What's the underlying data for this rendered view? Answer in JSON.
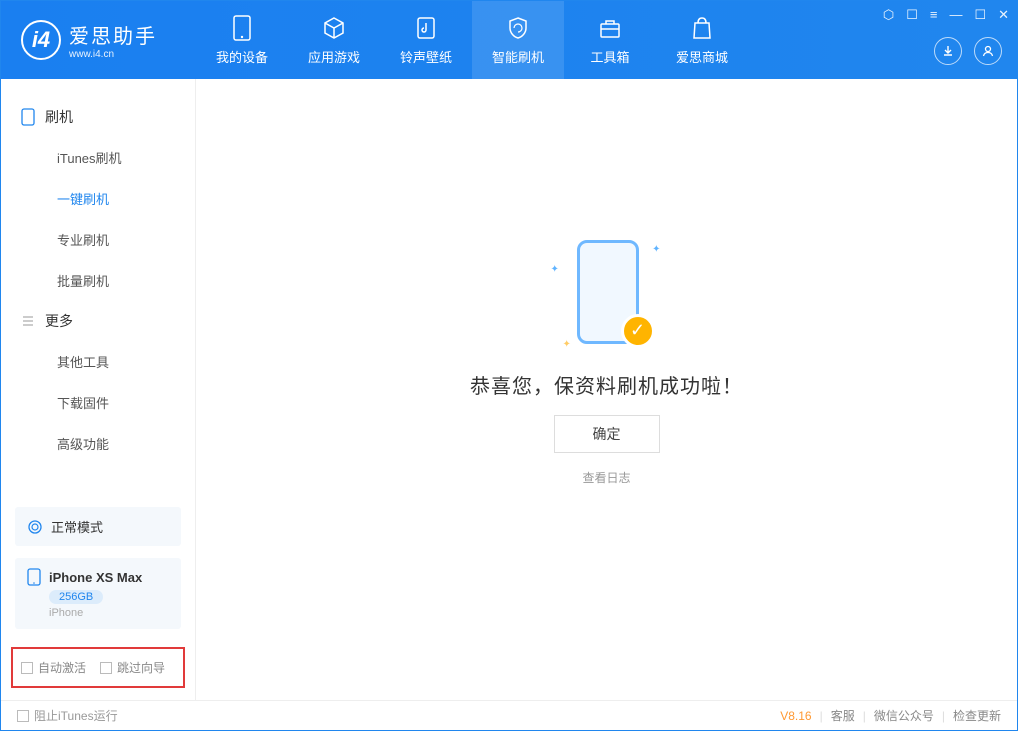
{
  "app": {
    "title": "爱思助手",
    "subtitle": "www.i4.cn"
  },
  "nav": {
    "items": [
      {
        "label": "我的设备"
      },
      {
        "label": "应用游戏"
      },
      {
        "label": "铃声壁纸"
      },
      {
        "label": "智能刷机"
      },
      {
        "label": "工具箱"
      },
      {
        "label": "爱思商城"
      }
    ]
  },
  "sidebar": {
    "group1_title": "刷机",
    "group1_items": [
      {
        "label": "iTunes刷机"
      },
      {
        "label": "一键刷机"
      },
      {
        "label": "专业刷机"
      },
      {
        "label": "批量刷机"
      }
    ],
    "group2_title": "更多",
    "group2_items": [
      {
        "label": "其他工具"
      },
      {
        "label": "下载固件"
      },
      {
        "label": "高级功能"
      }
    ],
    "mode_label": "正常模式",
    "device": {
      "name": "iPhone XS Max",
      "capacity": "256GB",
      "type": "iPhone"
    },
    "checkbox1": "自动激活",
    "checkbox2": "跳过向导"
  },
  "main": {
    "success_text": "恭喜您，保资料刷机成功啦！",
    "ok_button": "确定",
    "log_link": "查看日志"
  },
  "footer": {
    "block_itunes": "阻止iTunes运行",
    "version": "V8.16",
    "support": "客服",
    "wechat": "微信公众号",
    "update": "检查更新"
  }
}
